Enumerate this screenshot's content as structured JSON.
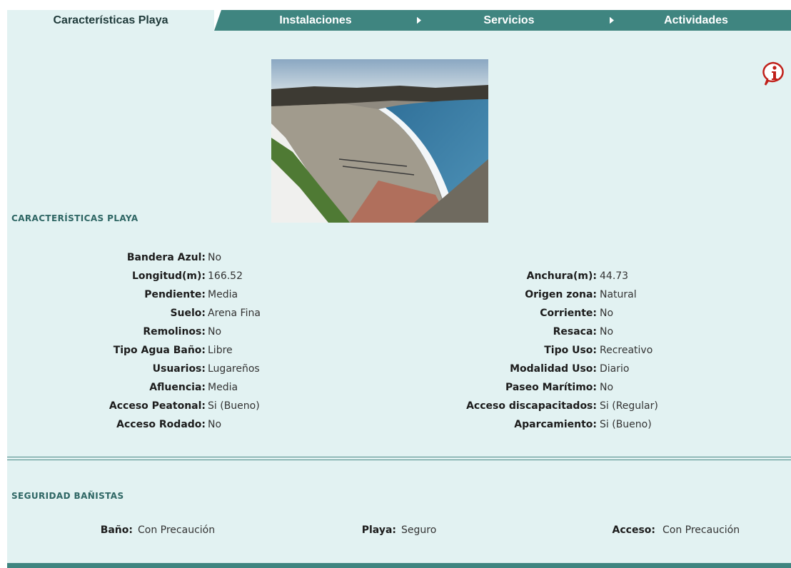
{
  "tabs": [
    {
      "label": "Características Playa",
      "active": true
    },
    {
      "label": "Instalaciones",
      "active": false
    },
    {
      "label": "Servicios",
      "active": false
    },
    {
      "label": "Actividades",
      "active": false
    }
  ],
  "colors": {
    "accent": "#3f8580",
    "panel": "#e2f2f2",
    "section_title": "#2e6664"
  },
  "info_icon": "info-icon",
  "photo": {
    "alt": "beach-photo"
  },
  "characteristics": {
    "title": "CARACTERÍSTICAS PLAYA",
    "left": [
      {
        "label": "Bandera Azul:",
        "value": "No"
      },
      {
        "label": "Longitud(m):",
        "value": "166.52"
      },
      {
        "label": "Pendiente:",
        "value": "Media"
      },
      {
        "label": "Suelo:",
        "value": "Arena Fina"
      },
      {
        "label": "Remolinos:",
        "value": "No"
      },
      {
        "label": "Tipo Agua Baño:",
        "value": "Libre"
      },
      {
        "label": "Usuarios:",
        "value": "Lugareños"
      },
      {
        "label": "Afluencia:",
        "value": "Media"
      },
      {
        "label": "Acceso Peatonal:",
        "value": "Si (Bueno)"
      },
      {
        "label": "Acceso Rodado:",
        "value": "No"
      }
    ],
    "right": [
      {
        "label": "Anchura(m):",
        "value": "44.73"
      },
      {
        "label": "Origen zona:",
        "value": "Natural"
      },
      {
        "label": "Corriente:",
        "value": "No"
      },
      {
        "label": "Resaca:",
        "value": "No"
      },
      {
        "label": "Tipo Uso:",
        "value": "Recreativo"
      },
      {
        "label": "Modalidad Uso:",
        "value": "Diario"
      },
      {
        "label": "Paseo Marítimo:",
        "value": "No"
      },
      {
        "label": "Acceso discapacitados:",
        "value": "Si (Regular)"
      },
      {
        "label": "Aparcamiento:",
        "value": "Si (Bueno)"
      }
    ]
  },
  "safety": {
    "title": "SEGURIDAD BAÑISTAS",
    "items": [
      {
        "label": "Baño:",
        "value": "Con Precaución"
      },
      {
        "label": "Playa:",
        "value": "Seguro"
      },
      {
        "label": "Acceso:",
        "value": "Con Precaución"
      }
    ]
  }
}
